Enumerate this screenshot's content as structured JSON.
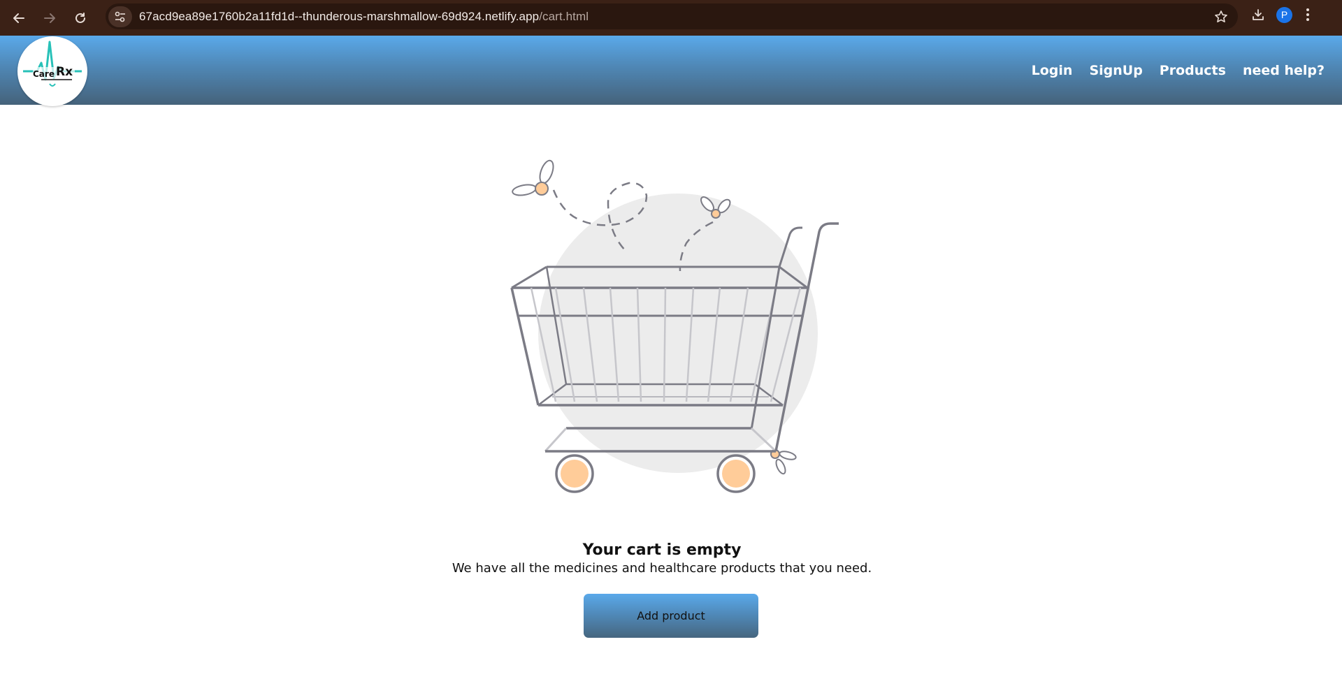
{
  "browser": {
    "url_host": "67acd9ea89e1760b2a11fd1d--thunderous-marshmallow-69d924.netlify.app",
    "url_path": "/cart.html",
    "profile_initial": "P"
  },
  "header": {
    "logo_text_care": "Care",
    "logo_text_rx": "Rx",
    "nav": [
      "Login",
      "SignUp",
      "Products",
      "need help?"
    ]
  },
  "cart": {
    "title": "Your cart is empty",
    "subtitle": "We have all the medicines and healthcare products that you need.",
    "button_label": "Add product"
  },
  "colors": {
    "browser_bg": "#3b2116",
    "header_top": "#5aa9ea",
    "header_bottom": "#45627a",
    "wheel": "#ffcc99"
  }
}
